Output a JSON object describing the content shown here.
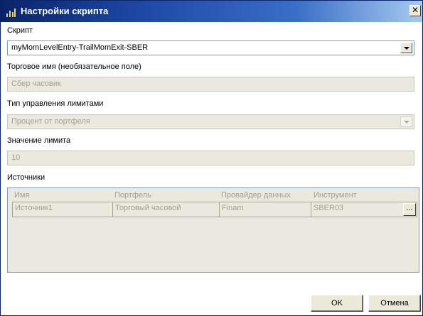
{
  "window": {
    "title": "Настройки скрипта",
    "icon": "chart-bars-icon",
    "close_symbol": "✕"
  },
  "script": {
    "label": "Скрипт",
    "value": "myMomLevelEntry-TrailMomExit-SBER"
  },
  "trade_name": {
    "label": "Торговое имя (необязательное поле)",
    "value": "Сбер часовик"
  },
  "limit_type": {
    "label": "Тип управления лимитами",
    "value": "Процент от портфеля"
  },
  "limit_value": {
    "label": "Значение лимита",
    "value": "10"
  },
  "sources": {
    "label": "Источники",
    "columns": [
      "Имя",
      "Портфель",
      "Провайдер данных",
      "Инструмент"
    ],
    "rows": [
      {
        "name": "Источник1",
        "portfolio": "Торговый часовой",
        "provider": "Finam",
        "instrument": "SBER03",
        "browse_label": "..."
      }
    ]
  },
  "buttons": {
    "ok": "OK",
    "cancel": "Отмена"
  }
}
